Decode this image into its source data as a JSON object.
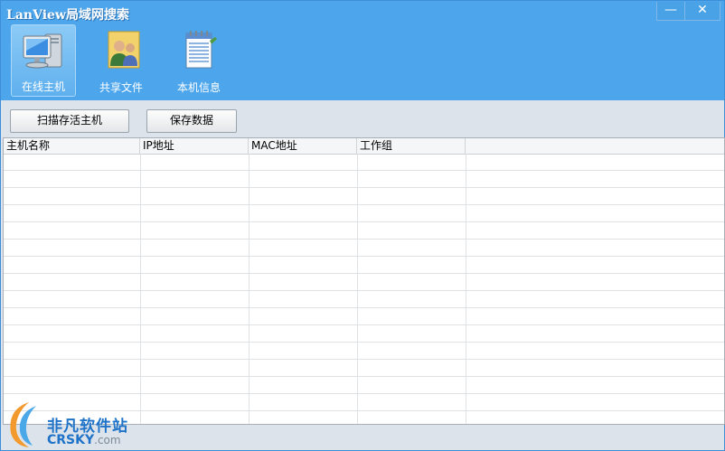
{
  "window": {
    "title": "LanView局域网搜索",
    "controls": {
      "minimize": "—",
      "close": "✕"
    }
  },
  "toolbar": {
    "items": [
      {
        "label": "在线主机",
        "icon": "computer-icon",
        "active": true
      },
      {
        "label": "共享文件",
        "icon": "users-share-icon",
        "active": false
      },
      {
        "label": "本机信息",
        "icon": "notepad-icon",
        "active": false
      }
    ]
  },
  "actions": {
    "scan_label": "扫描存活主机",
    "save_label": "保存数据"
  },
  "table": {
    "columns": [
      "主机名称",
      "IP地址",
      "MAC地址",
      "工作组"
    ],
    "rows": []
  },
  "watermark": {
    "cn": "非凡软件站",
    "en": "CRSKY",
    "domain": ".com"
  },
  "colors": {
    "titlebar": "#4da6ec",
    "accent": "#1e73c8"
  }
}
